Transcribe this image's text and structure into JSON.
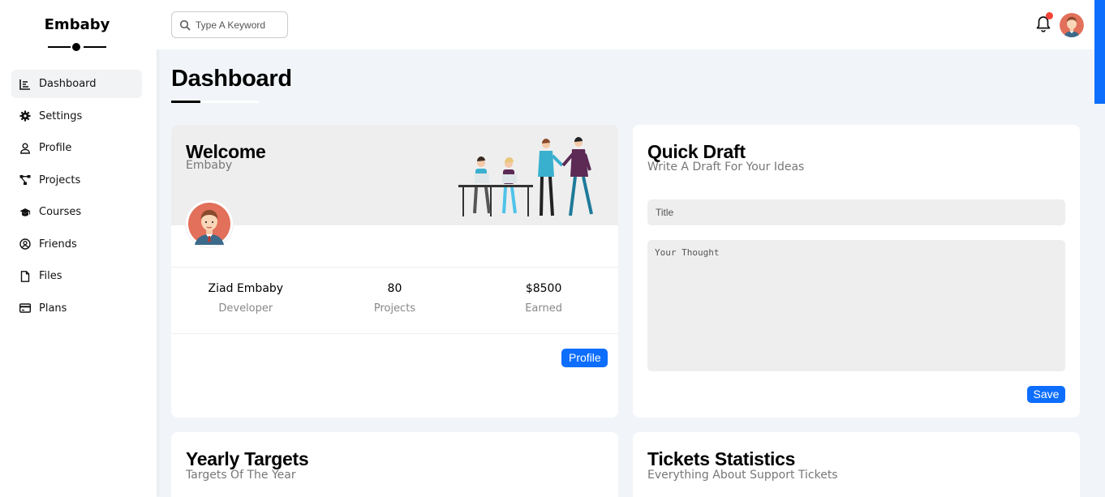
{
  "brand": {
    "name": "Embaby"
  },
  "sidebar": {
    "items": [
      {
        "label": "Dashboard",
        "icon": "chart-icon",
        "active": true
      },
      {
        "label": "Settings",
        "icon": "gear-icon"
      },
      {
        "label": "Profile",
        "icon": "user-icon"
      },
      {
        "label": "Projects",
        "icon": "diagram-icon"
      },
      {
        "label": "Courses",
        "icon": "graduation-cap-icon"
      },
      {
        "label": "Friends",
        "icon": "user-circle-icon"
      },
      {
        "label": "Files",
        "icon": "file-icon"
      },
      {
        "label": "Plans",
        "icon": "credit-card-icon"
      }
    ]
  },
  "search": {
    "placeholder": "Type A Keyword"
  },
  "page": {
    "title": "Dashboard"
  },
  "welcome": {
    "title": "Welcome",
    "subtitle": "Embaby",
    "stats": [
      {
        "value": "Ziad Embaby",
        "label": "Developer"
      },
      {
        "value": "80",
        "label": "Projects"
      },
      {
        "value": "$8500",
        "label": "Earned"
      }
    ],
    "button": "Profile"
  },
  "draft": {
    "title": "Quick Draft",
    "subtitle": "Write A Draft For Your Ideas",
    "title_placeholder": "Title",
    "thought_placeholder": "Your Thought",
    "button": "Save"
  },
  "yearly": {
    "title": "Yearly Targets",
    "subtitle": "Targets Of The Year"
  },
  "tickets": {
    "title": "Tickets Statistics",
    "subtitle": "Everything About Support Tickets"
  },
  "colors": {
    "accent": "#0d6efd",
    "notification": "#f44336",
    "header_bg": "#eeeeee",
    "page_bg": "#f1f5f9"
  }
}
